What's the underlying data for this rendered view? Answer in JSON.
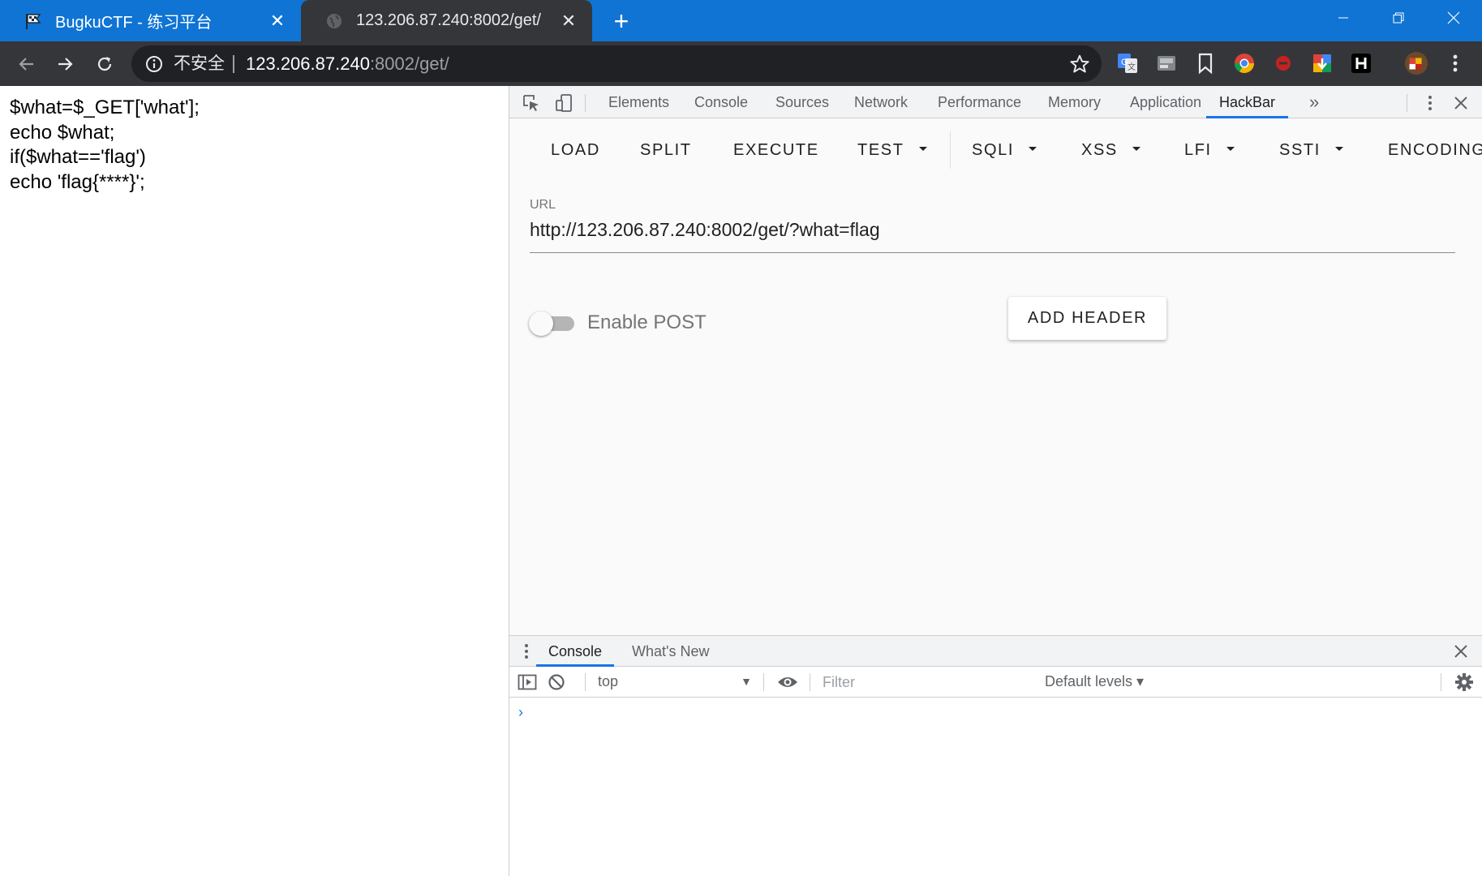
{
  "browser": {
    "tabs": [
      {
        "title": "BugkuCTF - 练习平台",
        "icon": "flag-icon",
        "active": false
      },
      {
        "title": "123.206.87.240:8002/get/",
        "icon": "globe-icon",
        "active": true
      }
    ],
    "close_glyph": "✕",
    "new_tab_glyph": "+",
    "address_bar": {
      "security_label": "不安全",
      "url_host": "123.206.87.240",
      "url_path": ":8002/get/"
    },
    "extensions": [
      "google-translate-icon",
      "image-extension-icon",
      "bookmark-icon",
      "chrome-icon",
      "red-extension-icon",
      "download-extension-icon",
      "hackbar-h-icon",
      "profile-avatar-icon"
    ]
  },
  "page": {
    "code_lines": [
      "$what=$_GET['what'];",
      "echo $what;",
      "if($what=='flag')",
      "echo 'flag{****}';"
    ]
  },
  "devtools": {
    "tabs": [
      "Elements",
      "Console",
      "Sources",
      "Network",
      "Performance",
      "Memory",
      "Application",
      "HackBar"
    ],
    "active_tab": "HackBar",
    "more_tabs_glyph": "»"
  },
  "hackbar": {
    "menu": {
      "load": "LOAD",
      "split": "SPLIT",
      "execute": "EXECUTE",
      "test": "TEST",
      "sqli": "SQLI",
      "xss": "XSS",
      "lfi": "LFI",
      "ssti": "SSTI",
      "encoding": "ENCODING"
    },
    "url_label": "URL",
    "url_value": "http://123.206.87.240:8002/get/?what=flag",
    "enable_post_label": "Enable POST",
    "enable_post": false,
    "add_header_label": "ADD HEADER"
  },
  "drawer": {
    "tabs": [
      "Console",
      "What's New"
    ],
    "active_tab": "Console",
    "context": "top",
    "filter_placeholder": "Filter",
    "levels": "Default levels ▾",
    "prompt": "›"
  },
  "colors": {
    "tabstrip": "#0f74d4",
    "toolbar": "#35363a",
    "accent": "#1a73e8"
  }
}
